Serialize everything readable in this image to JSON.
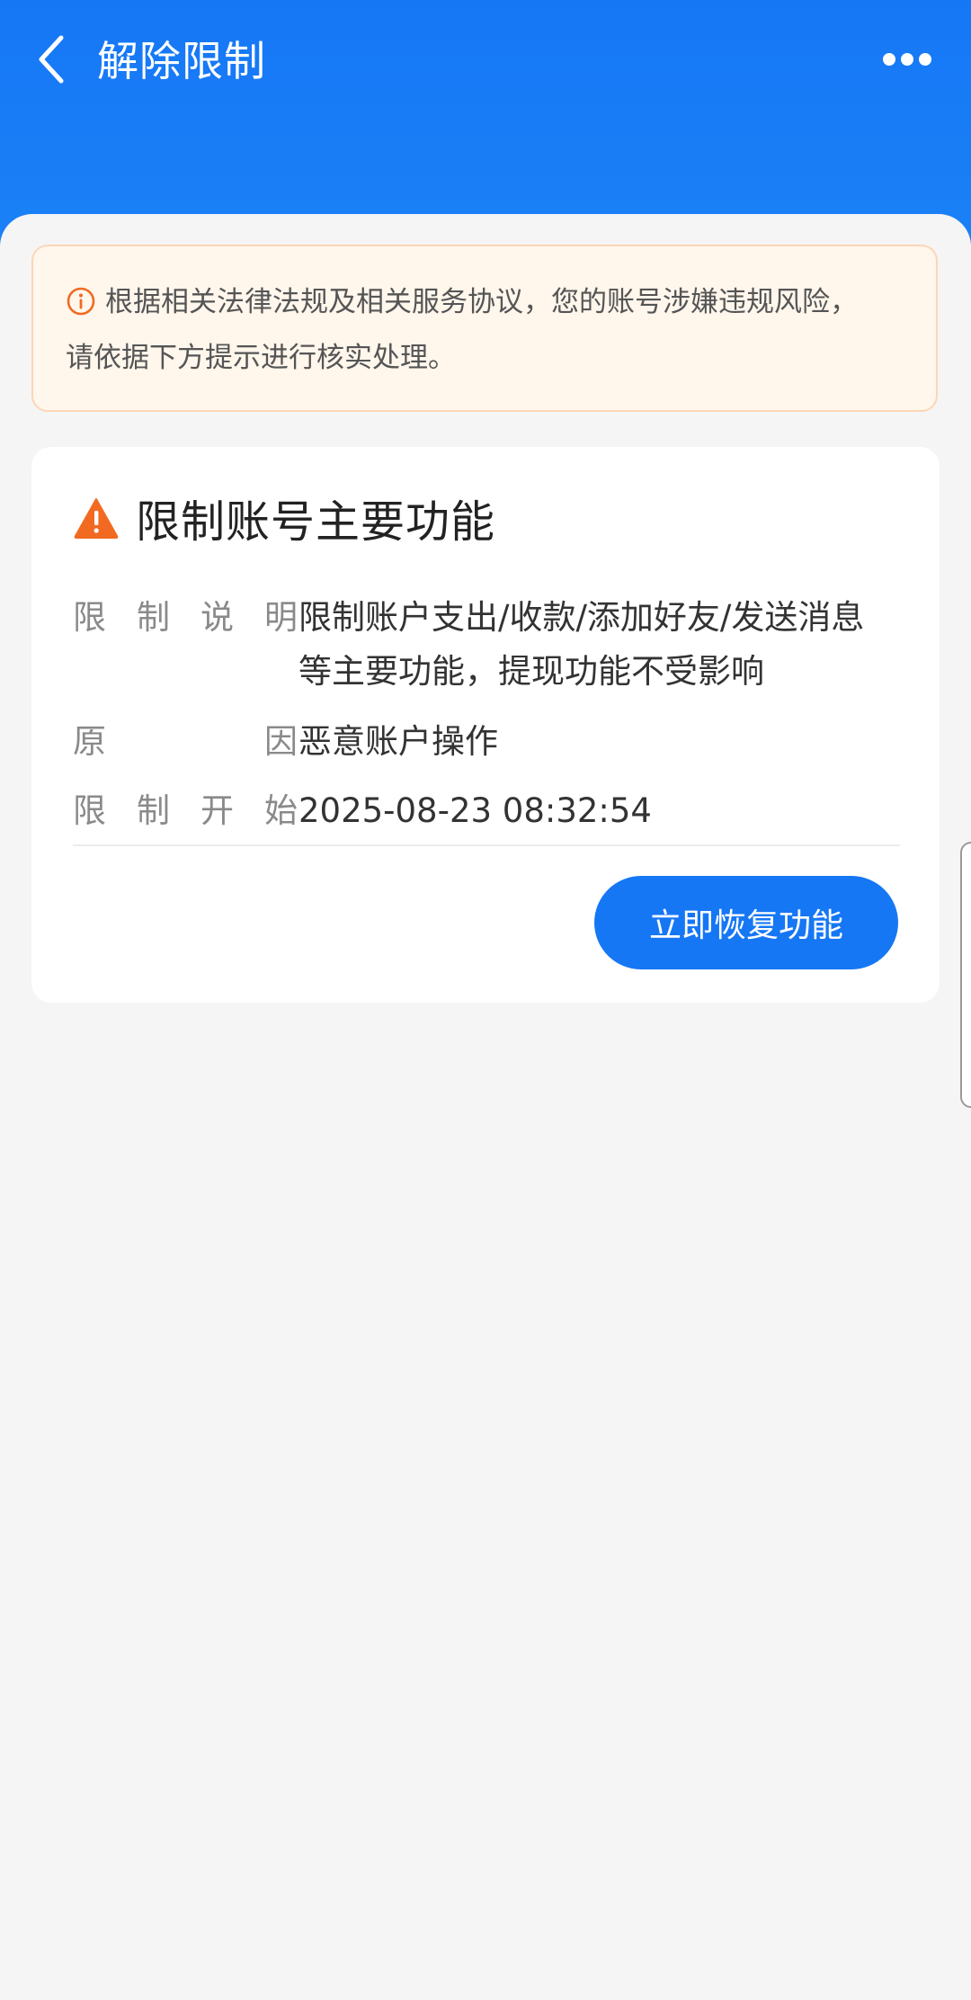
{
  "header": {
    "title": "解除限制",
    "back_icon": "chevron-left-icon",
    "more_icon": "more-dots-icon",
    "color": "#1677f5"
  },
  "notice": {
    "icon": "info-circle-icon",
    "text_line1": "根据相关法律法规及相关服务协议，您的账号涉嫌违规风险，",
    "text_line2": "请依据下方提示进行核实处理。",
    "accent": "#f26a21"
  },
  "card": {
    "icon": "warning-triangle-icon",
    "title": "限制账号主要功能",
    "rows": [
      {
        "label_chars": [
          "限",
          "制",
          "说",
          "明"
        ],
        "value_line1": "限制账户支出/收款/添加好友/发送消息",
        "value_line2": "等主要功能，提现功能不受影响"
      },
      {
        "label_chars": [
          "原",
          "因"
        ],
        "value_line1": "恶意账户操作"
      },
      {
        "label_chars": [
          "限",
          "制",
          "开",
          "始"
        ],
        "value_line1": "2025-08-23 08:32:54"
      }
    ],
    "button_label": "立即恢复功能",
    "button_color": "#1677f5"
  }
}
